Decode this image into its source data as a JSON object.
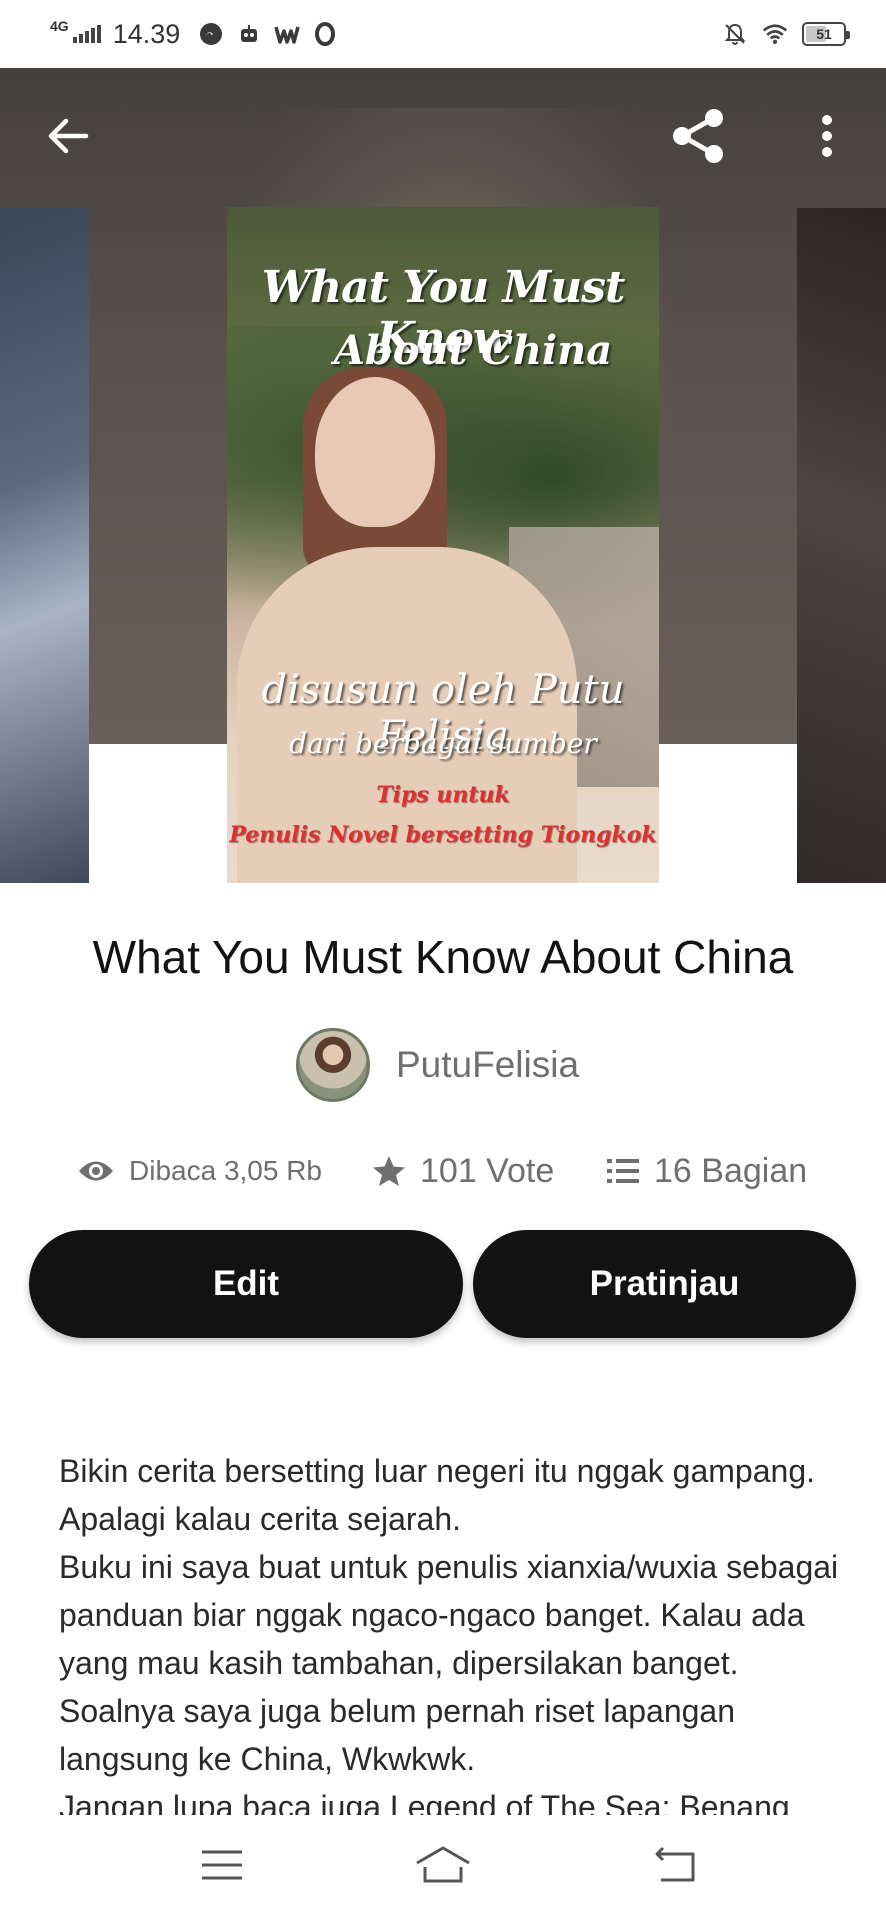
{
  "status_bar": {
    "network": "4G",
    "time": "14.39",
    "battery": "51",
    "icons_left": [
      "signal-icon",
      "messenger-icon",
      "bot-icon",
      "wattpad-icon",
      "opera-icon"
    ],
    "icons_right": [
      "mute-notifications-icon",
      "wifi-icon",
      "battery-icon"
    ]
  },
  "toolbar": {
    "back_icon": "arrow-left-icon",
    "share_icon": "share-icon",
    "menu_icon": "more-vertical-icon"
  },
  "cover": {
    "line1": "What You Must Know",
    "line2": "About China",
    "line3": "disusun oleh Putu Felisia",
    "line4": "dari berbagai sumber",
    "line5": "Tips untuk",
    "line6": "Penulis Novel bersetting Tiongkok"
  },
  "story": {
    "title": "What You Must Know About China",
    "author": "PutuFelisia"
  },
  "stats": {
    "reads": "Dibaca 3,05 Rb",
    "votes": "101 Vote",
    "parts": "16 Bagian"
  },
  "actions": {
    "edit_label": "Edit",
    "preview_label": "Pratinjau"
  },
  "description": {
    "lines": [
      "Bikin cerita bersetting luar negeri itu nggak gampang. Apalagi kalau cerita sejarah.",
      "Buku ini saya buat untuk penulis xianxia/wuxia sebagai panduan biar nggak ngaco-ngaco banget. Kalau ada yang mau kasih tambahan, dipersilakan banget. Soalnya saya juga belum pernah riset lapangan langsung ke China, Wkwkwk.",
      "Jangan lupa baca juga Legend of The Sea: Benang"
    ]
  },
  "navbar": {
    "menu_icon": "menu-icon",
    "home_icon": "home-icon",
    "back_icon": "back-icon"
  },
  "colors": {
    "button_bg": "#121212",
    "button_text": "#ffffff",
    "muted_text": "#6f6f6f"
  }
}
